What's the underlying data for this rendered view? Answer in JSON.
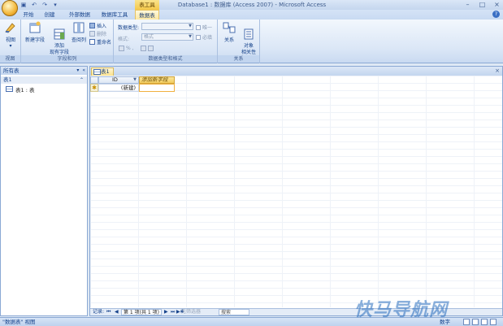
{
  "window": {
    "title": "Database1 : 数据库 (Access 2007) - Microsoft Access",
    "context_group": "表工具",
    "controls": [
      "–",
      "□",
      "×"
    ]
  },
  "qat": [
    "save-icon",
    "undo-icon",
    "redo-icon",
    "customize-icon"
  ],
  "tabs": [
    {
      "label": "开始"
    },
    {
      "label": "创建"
    },
    {
      "label": "外部数据"
    },
    {
      "label": "数据库工具"
    },
    {
      "label": "数据表",
      "active": true
    }
  ],
  "ribbon": {
    "views": {
      "label": "视图",
      "button": "视图"
    },
    "fields": {
      "label": "字段和列",
      "new_field": "新建字段",
      "add_existing": "添加\n现有字段",
      "lookup_column": "查阅列",
      "insert": "插入",
      "delete": "删除",
      "rename": "重命名"
    },
    "datatype": {
      "label": "数据类型和格式",
      "type_label": "数据类型:",
      "format_label": "格式:",
      "format_value": "格式",
      "unique": "唯一",
      "required": "必填",
      "number_format": "% ,"
    },
    "relationships": {
      "label": "关系",
      "relationships": "关系",
      "dependencies": "对象\n相关性"
    }
  },
  "nav": {
    "header": "所有表",
    "group": "表1",
    "item": "表1 : 表"
  },
  "doc": {
    "tab": "表1",
    "columns": [
      "ID",
      "添加新字段"
    ],
    "new_row": "(新建)",
    "new_row_marker": "✱"
  },
  "recnav": {
    "label": "记录:",
    "position": "第 1 项(共 1 项)",
    "filter": "无筛选器",
    "search": "搜索"
  },
  "status": {
    "text": "\"数据表\" 视图",
    "mode": "数字"
  },
  "watermark": "快马导航网",
  "colors": {
    "accent": "#15428b",
    "active_tab": "#fbe7a4",
    "ribbon": "#dae6f6"
  }
}
